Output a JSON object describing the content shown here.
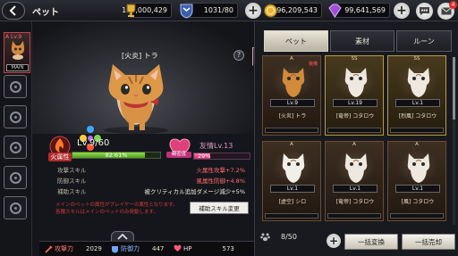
{
  "topbar": {
    "title": "ペット",
    "trophy_value": "100,000,429",
    "stamina": "1031/80",
    "gold": "96,209,543",
    "gems": "99,641,569",
    "notification_count": "4"
  },
  "pet": {
    "name": "[火炎] トラ",
    "rank": "A",
    "level_text": "Lv.9/60",
    "element": "火属性",
    "exp_percent": "82.61%",
    "exp_fraction": 0.8261,
    "affection_text": "友情Lv.13",
    "affection_label": "親密度",
    "affection_percent": "29%",
    "affection_fraction": 0.29,
    "slot_level": "A Lv.9",
    "slot_tag": "MAIN"
  },
  "skills": [
    {
      "label": "攻撃スキル",
      "value": "火属性攻撃+7.2%",
      "color": "#ff6a6a"
    },
    {
      "label": "防御スキル",
      "value": "風属性防御+4.8%",
      "color": "#ff6a6a"
    },
    {
      "label": "補助スキル",
      "value": "被クリティカル追加ダメージ減少+5%",
      "color": "#f0ece2"
    }
  ],
  "warning": {
    "line1": "メインのペットの属性がプレイヤーの属性となります。",
    "line2": "各種スキルはメインのペットのみ発動します。"
  },
  "aux_button": "補助スキル変更",
  "bottom_stats": {
    "atk_label": "攻撃力",
    "atk": "2029",
    "def_label": "防御力",
    "def": "447",
    "hp_label": "HP",
    "hp": "573"
  },
  "tabs": [
    "ペット",
    "素材",
    "ルーン"
  ],
  "cards": [
    {
      "rank": "A",
      "equip": "装備",
      "lv": "Lv.9",
      "name": "[火炎] トラ",
      "fur": "#d38a3a"
    },
    {
      "rank": "SS",
      "equip": "",
      "lv": "Lv.19",
      "name": "[竜帝] コタロウ",
      "fur": "#eee8de"
    },
    {
      "rank": "SS",
      "equip": "",
      "lv": "Lv.1",
      "name": "[烈風] コタロウ",
      "fur": "#eee8de"
    },
    {
      "rank": "A",
      "equip": "",
      "lv": "Lv.1",
      "name": "[虚空] シロ",
      "fur": "#f2efe8"
    },
    {
      "rank": "A",
      "equip": "",
      "lv": "Lv.1",
      "name": "[竜帝] コタロウ",
      "fur": "#eee8de"
    },
    {
      "rank": "A",
      "equip": "",
      "lv": "Lv.1",
      "name": "[風] コタロウ",
      "fur": "#eee8de"
    }
  ],
  "inventory": {
    "count": "8/50",
    "convert_btn": "一括変換",
    "sell_btn": "一括売却"
  }
}
